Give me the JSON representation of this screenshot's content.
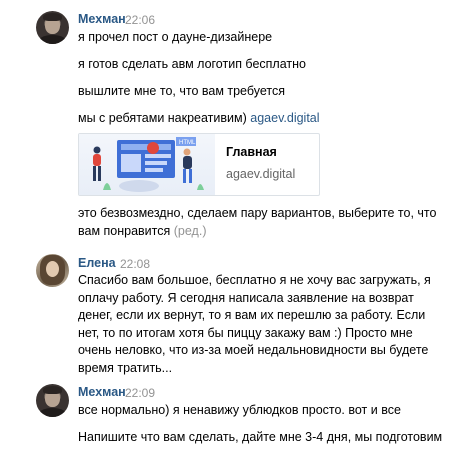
{
  "messages": [
    {
      "author": "Мехман",
      "time": "22:06",
      "lines": [
        "я прочел пост о дауне-дизайнере",
        "я готов сделать авм логотип бесплатно",
        "вышлите мне то, что вам требуется",
        "мы с ребятами накреативим)"
      ],
      "link_text": "agaev.digital",
      "card": {
        "title": "Главная",
        "subtitle": "agaev.digital",
        "image_label": "HTML"
      },
      "after_lines": [
        "это безвозмездно, сделаем пару вариантов, выберите то, что",
        "вам понравится"
      ],
      "edited_label": "(ред.)"
    },
    {
      "author": "Елена",
      "time": "22:08",
      "lines": [
        "Спасибо вам большое, бесплатно я не хочу вас загружать, я",
        "оплачу работу. Я сегодня написала заявление на возврат",
        "денег, если их вернут, то я вам их перешлю за работу. Если",
        "нет, то по итогам хотя бы пиццу закажу вам :) Просто мне",
        "очень неловко, что из-за моей недальновидности вы будете",
        "время тратить..."
      ]
    },
    {
      "author": "Мехман",
      "time": "22:09",
      "lines": [
        "все нормально) я ненавижу ублюдков просто. вот и все",
        "Напишите что вам сделать, дайте мне 3-4 дня, мы подготовим"
      ]
    }
  ]
}
